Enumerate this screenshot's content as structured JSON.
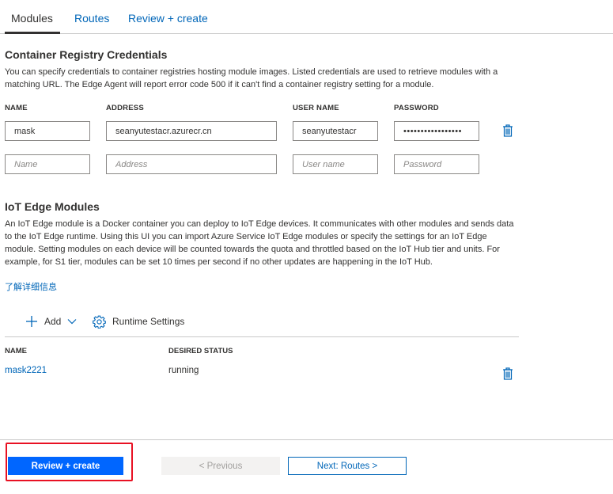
{
  "tabs": [
    {
      "label": "Modules",
      "active": true
    },
    {
      "label": "Routes",
      "active": false
    },
    {
      "label": "Review + create",
      "active": false
    }
  ],
  "registry": {
    "title": "Container Registry Credentials",
    "description": "You can specify credentials to container registries hosting module images. Listed credentials are used to retrieve modules with a matching URL. The Edge Agent will report error code 500 if it can't find a container registry setting for a module.",
    "columns": {
      "name": "NAME",
      "address": "ADDRESS",
      "user": "USER NAME",
      "password": "PASSWORD"
    },
    "row": {
      "name": "mask",
      "address": "seanyutestacr.azurecr.cn",
      "user": "seanyutestacr",
      "password": "•••••••••••••••••"
    },
    "placeholders": {
      "name": "Name",
      "address": "Address",
      "user": "User name",
      "password": "Password"
    }
  },
  "modules": {
    "title": "IoT Edge Modules",
    "description": "An IoT Edge module is a Docker container you can deploy to IoT Edge devices. It communicates with other modules and sends data to the IoT Edge runtime. Using this UI you can import Azure Service IoT Edge modules or specify the settings for an IoT Edge module. Setting modules on each device will be counted towards the quota and throttled based on the IoT Hub tier and units. For example, for S1 tier, modules can be set 10 times per second if no other updates are happening in the IoT Hub.",
    "learn_more": "了解详细信息",
    "add_label": "Add",
    "runtime_label": "Runtime Settings",
    "columns": {
      "name": "NAME",
      "status": "DESIRED STATUS"
    },
    "rows": [
      {
        "name": "mask2221",
        "status": "running"
      }
    ]
  },
  "footer": {
    "review_create": "Review + create",
    "previous": "< Previous",
    "next": "Next: Routes >"
  },
  "colors": {
    "accent": "#0066b8",
    "primary_button": "#0066ff",
    "highlight": "#e81123"
  },
  "icons": {
    "delete": "trash-icon",
    "add": "plus-icon",
    "dropdown": "chevron-down-icon",
    "settings": "gear-icon"
  }
}
